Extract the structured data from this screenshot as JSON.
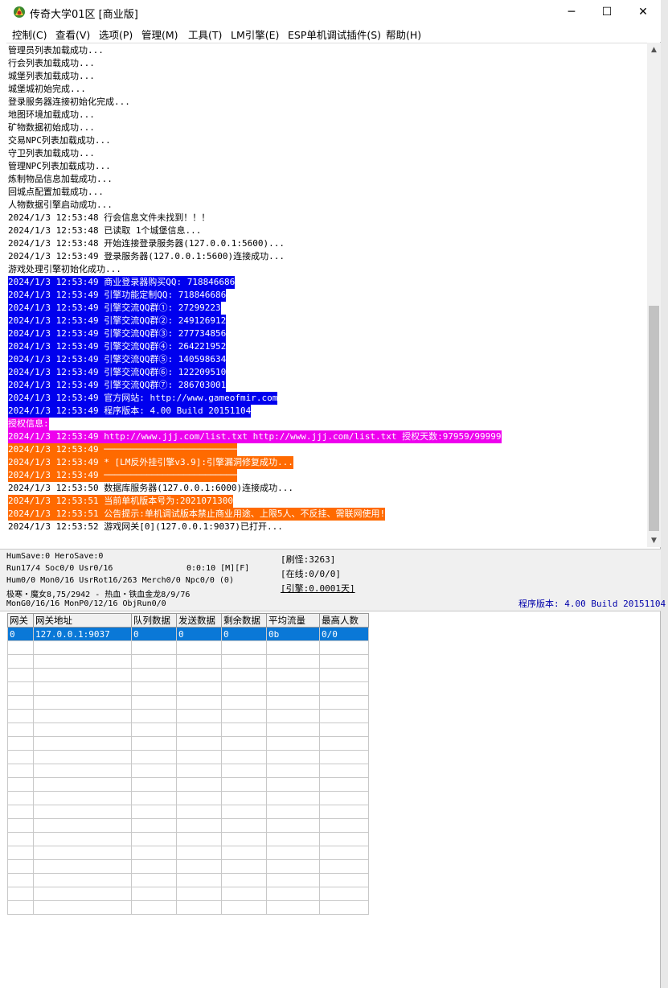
{
  "window": {
    "title": "传奇大学01区 [商业版]",
    "minimize": "─",
    "maximize": "☐",
    "close": "✕"
  },
  "menu": [
    "控制(C)",
    "查看(V)",
    "选项(P)",
    "管理(M)",
    "工具(T)",
    "LM引擎(E)",
    "ESP单机调试插件(S)",
    "帮助(H)"
  ],
  "log": [
    {
      "text": "管理员列表加载成功...",
      "hl": ""
    },
    {
      "text": "行会列表加载成功...",
      "hl": ""
    },
    {
      "text": "城堡列表加载成功...",
      "hl": ""
    },
    {
      "text": "城堡城初始完成...",
      "hl": ""
    },
    {
      "text": "登录服务器连接初始化完成...",
      "hl": ""
    },
    {
      "text": "地图环境加载成功...",
      "hl": ""
    },
    {
      "text": "矿物数据初始成功...",
      "hl": ""
    },
    {
      "text": "交易NPC列表加载成功...",
      "hl": ""
    },
    {
      "text": "守卫列表加载成功...",
      "hl": ""
    },
    {
      "text": "管理NPC列表加载成功...",
      "hl": ""
    },
    {
      "text": "炼制物品信息加载成功...",
      "hl": ""
    },
    {
      "text": "回城点配置加载成功...",
      "hl": ""
    },
    {
      "text": "人物数据引擎启动成功...",
      "hl": ""
    },
    {
      "text": "2024/1/3 12:53:48 行会信息文件未找到！！！",
      "hl": ""
    },
    {
      "text": "2024/1/3 12:53:48 已读取 1个城堡信息...",
      "hl": ""
    },
    {
      "text": "2024/1/3 12:53:48 开始连接登录服务器(127.0.0.1:5600)...",
      "hl": ""
    },
    {
      "text": "2024/1/3 12:53:49 登录服务器(127.0.0.1:5600)连接成功...",
      "hl": ""
    },
    {
      "text": "游戏处理引擎初始化成功...",
      "hl": ""
    },
    {
      "text": "2024/1/3 12:53:49 商业登录器购买QQ: 718846686",
      "hl": "blue"
    },
    {
      "text": "2024/1/3 12:53:49 引擎功能定制QQ: 718846686",
      "hl": "blue"
    },
    {
      "text": "2024/1/3 12:53:49 引擎交流QQ群①: 27299223",
      "hl": "blue"
    },
    {
      "text": "2024/1/3 12:53:49 引擎交流QQ群②: 249126912",
      "hl": "blue"
    },
    {
      "text": "2024/1/3 12:53:49 引擎交流QQ群③: 277734856",
      "hl": "blue"
    },
    {
      "text": "2024/1/3 12:53:49 引擎交流QQ群④: 264221952",
      "hl": "blue"
    },
    {
      "text": "2024/1/3 12:53:49 引擎交流QQ群⑤: 140598634",
      "hl": "blue"
    },
    {
      "text": "2024/1/3 12:53:49 引擎交流QQ群⑥: 122209510",
      "hl": "blue"
    },
    {
      "text": "2024/1/3 12:53:49 引擎交流QQ群⑦: 286703001",
      "hl": "blue"
    },
    {
      "text": "2024/1/3 12:53:49 官方网站: http://www.gameofmir.com",
      "hl": "blue"
    },
    {
      "text": "2024/1/3 12:53:49 程序版本: 4.00 Build 20151104",
      "hl": "blue"
    },
    {
      "text": "授权信息:",
      "hl": "mag"
    },
    {
      "text": "2024/1/3 12:53:49 http://www.jjj.com/list.txt http://www.jjj.com/list.txt 授权天数:97959/99999",
      "hl": "mag"
    },
    {
      "text": "2024/1/3 12:53:49 ─────────────────────────",
      "hl": "orange"
    },
    {
      "text": "2024/1/3 12:53:49 * [LM反外挂引擎v3.9]:引擎漏洞修复成功...",
      "hl": "orange"
    },
    {
      "text": "2024/1/3 12:53:49 ─────────────────────────",
      "hl": "orange"
    },
    {
      "text": "2024/1/3 12:53:50 数据库服务器(127.0.0.1:6000)连接成功...",
      "hl": ""
    },
    {
      "text": "2024/1/3 12:53:51 当前单机版本号为:2021071300",
      "hl": "orange"
    },
    {
      "text": "2024/1/3 12:53:51 公告提示:单机调试版本禁止商业用途、上限5人、不反挂、需联网使用!",
      "hl": "orange"
    },
    {
      "text": "2024/1/3 12:53:52 游戏网关[0](127.0.0.1:9037)已打开...",
      "hl": ""
    }
  ],
  "status": {
    "line1": "HumSave:0 HeroSave:0",
    "line2": "Run17/4 Soc0/0 Usr0/16",
    "timer": "0:0:10 [M][F]",
    "line3": "Hum0/0 Mon0/16 UsrRot16/263 Merch0/0 Npc0/0 (0)",
    "line4": "极寒・魔女8,75/2942 - 热血・铁血金龙8/9/76",
    "line5": "MonG0/16/16 MonP0/12/16 ObjRun0/0",
    "refresh": "[刷怪:3263]",
    "online": "[在线:0/0/0]",
    "engine": "[引擎:0.0001天]",
    "version": "程序版本: 4.00 Build 20151104"
  },
  "grid": {
    "columns": [
      "网关",
      "网关地址",
      "队列数据",
      "发送数据",
      "剩余数据",
      "平均流量",
      "最高人数"
    ],
    "rows": [
      [
        "0",
        "127.0.0.1:9037",
        "0",
        "0",
        "0",
        "0b",
        "0/0"
      ]
    ]
  }
}
